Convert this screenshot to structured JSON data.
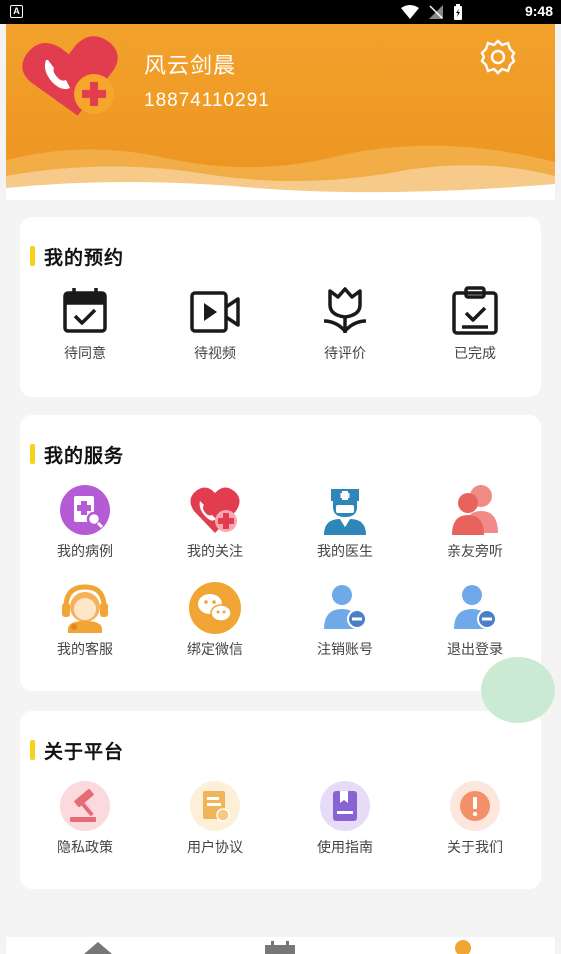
{
  "status_bar": {
    "app_badge": "A",
    "time": "9:48"
  },
  "profile": {
    "name": "风云剑晨",
    "phone": "18874110291"
  },
  "appointments": {
    "title": "我的预约",
    "items": [
      {
        "label": "待同意",
        "icon": "calendar-check-icon"
      },
      {
        "label": "待视频",
        "icon": "video-icon"
      },
      {
        "label": "待评价",
        "icon": "tulip-icon"
      },
      {
        "label": "已完成",
        "icon": "clipboard-check-icon"
      }
    ]
  },
  "services": {
    "title": "我的服务",
    "items": [
      {
        "label": "我的病例",
        "icon": "medical-record-icon"
      },
      {
        "label": "我的关注",
        "icon": "heart-plus-icon"
      },
      {
        "label": "我的医生",
        "icon": "doctor-icon"
      },
      {
        "label": "亲友旁听",
        "icon": "family-icon"
      },
      {
        "label": "我的客服",
        "icon": "customer-service-icon"
      },
      {
        "label": "绑定微信",
        "icon": "wechat-icon"
      },
      {
        "label": "注销账号",
        "icon": "user-remove-icon"
      },
      {
        "label": "退出登录",
        "icon": "logout-user-icon"
      }
    ]
  },
  "platform": {
    "title": "关于平台",
    "items": [
      {
        "label": "隐私政策",
        "icon": "gavel-icon"
      },
      {
        "label": "用户协议",
        "icon": "agreement-icon"
      },
      {
        "label": "使用指南",
        "icon": "guide-book-icon"
      },
      {
        "label": "关于我们",
        "icon": "info-icon"
      }
    ]
  },
  "colors": {
    "header": "#ef9a25",
    "accent_bar": "#f5d21c",
    "text": "#444444"
  }
}
